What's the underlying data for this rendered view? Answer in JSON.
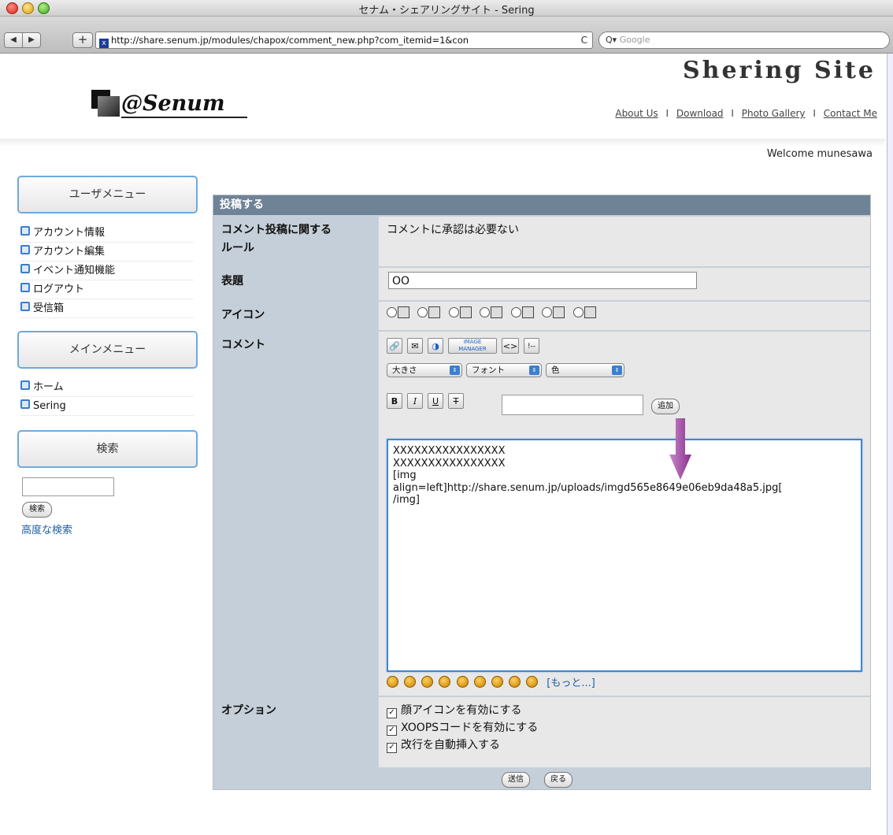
{
  "window": {
    "title": "セナム・シェアリングサイト - Sering"
  },
  "browser": {
    "back_label": "◀",
    "forward_label": "▶",
    "add_label": "+",
    "url": "http://share.senum.jp/modules/chapox/comment_new.php?com_itemid=1&con",
    "reload_label": "C",
    "search_placeholder": "Google"
  },
  "header": {
    "logo_text": "@Senum",
    "site_title": "Shering Site",
    "nav": [
      "About Us",
      "Download",
      "Photo Gallery",
      "Contact Me"
    ],
    "nav_sep": "I",
    "welcome": "Welcome munesawa"
  },
  "sidebar": {
    "user_menu_title": "ユーザメニュー",
    "user_menu_items": [
      "アカウント情報",
      "アカウント編集",
      "イベント通知機能",
      "ログアウト",
      "受信箱"
    ],
    "main_menu_title": "メインメニュー",
    "main_menu_items": [
      "ホーム",
      "Sering"
    ],
    "search_title": "検索",
    "search_button": "検索",
    "advanced_search": "高度な検索"
  },
  "form": {
    "heading": "投稿する",
    "rules_label": "コメント投稿に関する\nルール",
    "rules_label_1": "コメント投稿に関する",
    "rules_label_2": "ルール",
    "rules_value": "コメントに承認は必要ない",
    "subject_label": "表題",
    "subject_value": "OO",
    "icon_label": "アイコン",
    "comment_label": "コメント",
    "size_select": "大きさ",
    "font_select": "フォント",
    "color_select": "色",
    "bold_label": "B",
    "italic_label": "I",
    "underline_label": "U",
    "strike_label": "T",
    "add_button": "追加",
    "image_manager_label": "IMAGE MANAGER",
    "code_label": "<>",
    "quote_label": "!--",
    "comment_lines": [
      "XXXXXXXXXXXXXXXX",
      "XXXXXXXXXXXXXXXX",
      "[img",
      "align=left]http://share.senum.jp/uploads/imgd565e8649e06eb9da48a5.jpg[",
      "/img]"
    ],
    "more_smileys": "[もっと...]",
    "options_label": "オプション",
    "options": [
      "顔アイコンを有効にする",
      "XOOPSコードを有効にする",
      "改行を自動挿入する"
    ],
    "submit_button": "送信",
    "back_button": "戻る"
  },
  "colors": {
    "form_header_bg": "#6f8397",
    "label_bg": "#c5cfd9",
    "value_bg": "#e8e8e8",
    "accent_arrow": "#a44aa6",
    "link": "#1f5fa8"
  }
}
